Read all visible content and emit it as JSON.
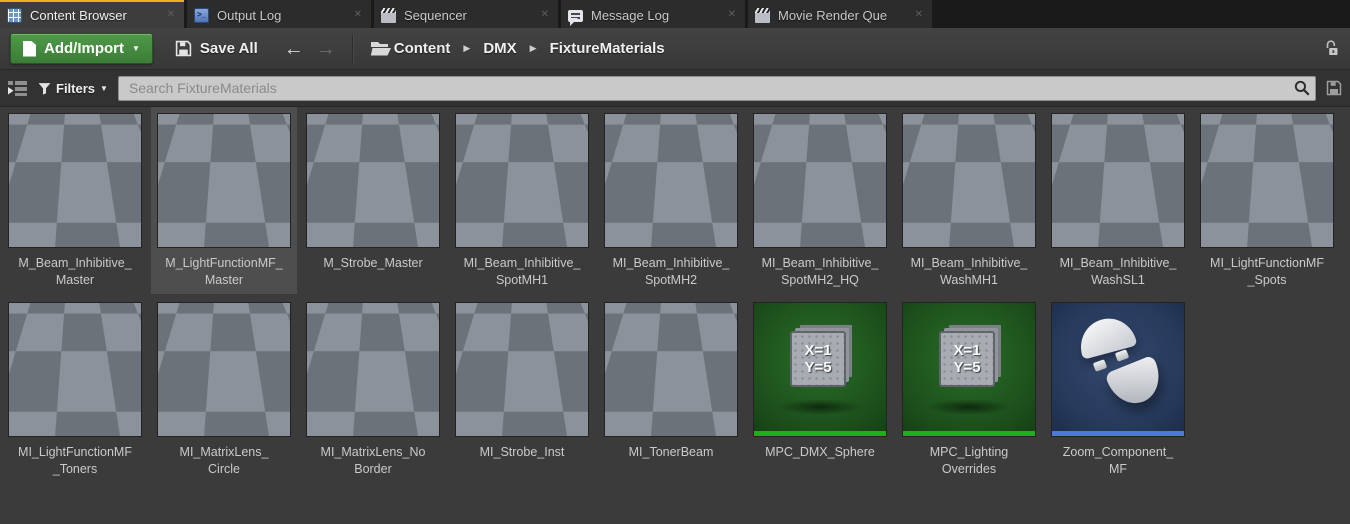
{
  "tab_bar": {
    "active_tab_accent": "#e9b51c",
    "tabs": [
      {
        "label": "Content Browser",
        "icon": "content-browser-icon",
        "active": true
      },
      {
        "label": "Output Log",
        "icon": "output-log-icon",
        "active": false
      },
      {
        "label": "Sequencer",
        "icon": "sequencer-icon",
        "active": false
      },
      {
        "label": "Message Log",
        "icon": "message-log-icon",
        "active": false
      },
      {
        "label": "Movie Render Que",
        "icon": "movie-render-queue-icon",
        "active": false
      }
    ]
  },
  "toolbar": {
    "add_import": {
      "label": "Add/Import",
      "color": "#3f8a3b"
    },
    "save_all": {
      "label": "Save All"
    },
    "breadcrumbs": [
      "Content",
      "DMX",
      "FixtureMaterials"
    ]
  },
  "filter_bar": {
    "filters_label": "Filters",
    "search": {
      "placeholder": "Search FixtureMaterials",
      "value": ""
    }
  },
  "asset_grid": {
    "mpc_icon_text": "X=1\nY=5",
    "bar_colors": {
      "material_master": "#3cbc3c",
      "material_instance": "#178617",
      "parameter_collection": "#1db01d",
      "material_function": "#4b79dd"
    },
    "assets": [
      {
        "name": "M_Beam_Inhibitive_\nMaster",
        "thumb": "beam",
        "bar": "#3cbc3c",
        "selected": false
      },
      {
        "name": "M_LightFunctionMF_\nMaster",
        "thumb": "white-sphere",
        "bar": "#3cbc3c",
        "selected": true
      },
      {
        "name": "M_Strobe_Master",
        "thumb": "dark-sphere",
        "bar": "#3cbc3c",
        "selected": false
      },
      {
        "name": "MI_Beam_Inhibitive_\nSpotMH1",
        "thumb": "beam-small",
        "bar": "#178617",
        "selected": false
      },
      {
        "name": "MI_Beam_Inhibitive_\nSpotMH2",
        "thumb": "beam",
        "bar": "#178617",
        "selected": false
      },
      {
        "name": "MI_Beam_Inhibitive_\nSpotMH2_HQ",
        "thumb": "beam",
        "bar": "#178617",
        "selected": false
      },
      {
        "name": "MI_Beam_Inhibitive_\nWashMH1",
        "thumb": "beam",
        "bar": "#178617",
        "selected": false
      },
      {
        "name": "MI_Beam_Inhibitive_\nWashSL1",
        "thumb": "beam",
        "bar": "#178617",
        "selected": false
      },
      {
        "name": "MI_LightFunctionMF\n_Spots",
        "thumb": "white-sphere",
        "bar": "#178617",
        "selected": false
      },
      {
        "name": "MI_LightFunctionMF\n_Toners",
        "thumb": "white-sphere",
        "bar": "#178617",
        "selected": false
      },
      {
        "name": "MI_MatrixLens_\nCircle",
        "thumb": "red-sphere",
        "bar": "#178617",
        "selected": false
      },
      {
        "name": "MI_MatrixLens_No\nBorder",
        "thumb": "orange-sphere",
        "bar": "#178617",
        "selected": false
      },
      {
        "name": "MI_Strobe_Inst",
        "thumb": "gray-sphere",
        "bar": "#178617",
        "selected": false
      },
      {
        "name": "MI_TonerBeam",
        "thumb": "beam",
        "bar": "#178617",
        "selected": false
      },
      {
        "name": "MPC_DMX_Sphere",
        "thumb": "mpc",
        "bar": "#1db01d",
        "selected": false
      },
      {
        "name": "MPC_Lighting\nOverrides",
        "thumb": "mpc",
        "bar": "#1db01d",
        "selected": false
      },
      {
        "name": "Zoom_Component_\nMF",
        "thumb": "mf",
        "bar": "#4b79dd",
        "selected": false
      }
    ]
  }
}
